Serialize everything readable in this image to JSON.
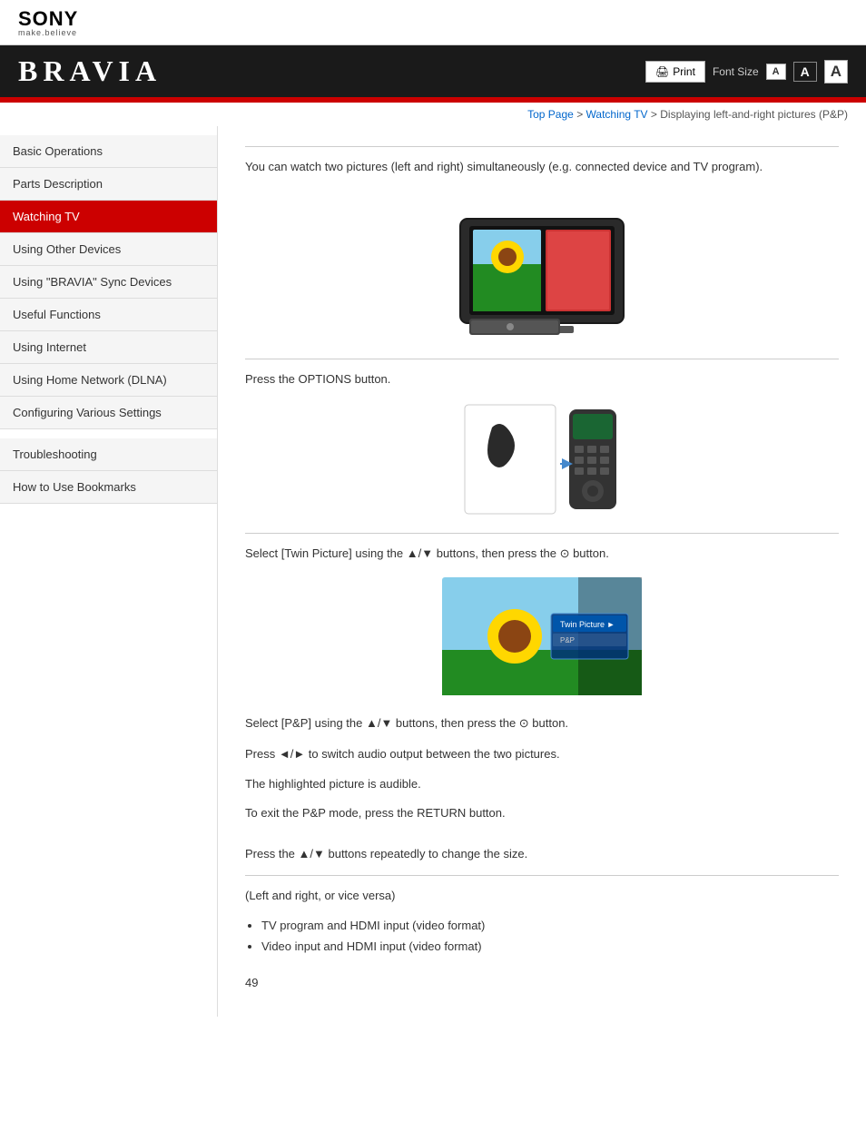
{
  "header": {
    "sony_text": "SONY",
    "sony_tagline": "make.believe"
  },
  "bravia_bar": {
    "title": "BRAVIA",
    "print_label": "Print",
    "font_size_label": "Font Size",
    "font_small": "A",
    "font_medium": "A",
    "font_large": "A"
  },
  "breadcrumb": {
    "top_page": "Top Page",
    "watching_tv": "Watching TV",
    "current": "Displaying left-and-right pictures (P&P)"
  },
  "sidebar": {
    "items": [
      {
        "label": "Basic Operations",
        "active": false
      },
      {
        "label": "Parts Description",
        "active": false
      },
      {
        "label": "Watching TV",
        "active": true
      },
      {
        "label": "Using Other Devices",
        "active": false
      },
      {
        "label": "Using \"BRAVIA\" Sync Devices",
        "active": false
      },
      {
        "label": "Useful Functions",
        "active": false
      },
      {
        "label": "Using Internet",
        "active": false
      },
      {
        "label": "Using Home Network (DLNA)",
        "active": false
      },
      {
        "label": "Configuring Various Settings",
        "active": false
      },
      {
        "label": "Troubleshooting",
        "active": false,
        "section_top": true
      },
      {
        "label": "How to Use Bookmarks",
        "active": false
      }
    ]
  },
  "content": {
    "intro_text": "You can watch two pictures (left and right) simultaneously (e.g. connected device and TV program).",
    "step1_text": "Press the OPTIONS button.",
    "step2_text": "Select [Twin Picture] using the ▲/▼ buttons, then press the ⊙ button.",
    "step3_instructions": [
      "Select [P&P] using the ▲/▼ buttons, then press the ⊙ button.",
      "Press ◄/► to switch audio output between the two pictures.",
      "The highlighted picture is audible."
    ],
    "exit_text": "To exit the P&P mode, press the RETURN button.",
    "size_text": "Press the ▲/▼ buttons repeatedly to change the size.",
    "compatible_label": "(Left and right, or vice versa)",
    "compatible_items": [
      "TV program and HDMI input (video format)",
      "Video input and HDMI input (video format)"
    ],
    "page_number": "49"
  }
}
